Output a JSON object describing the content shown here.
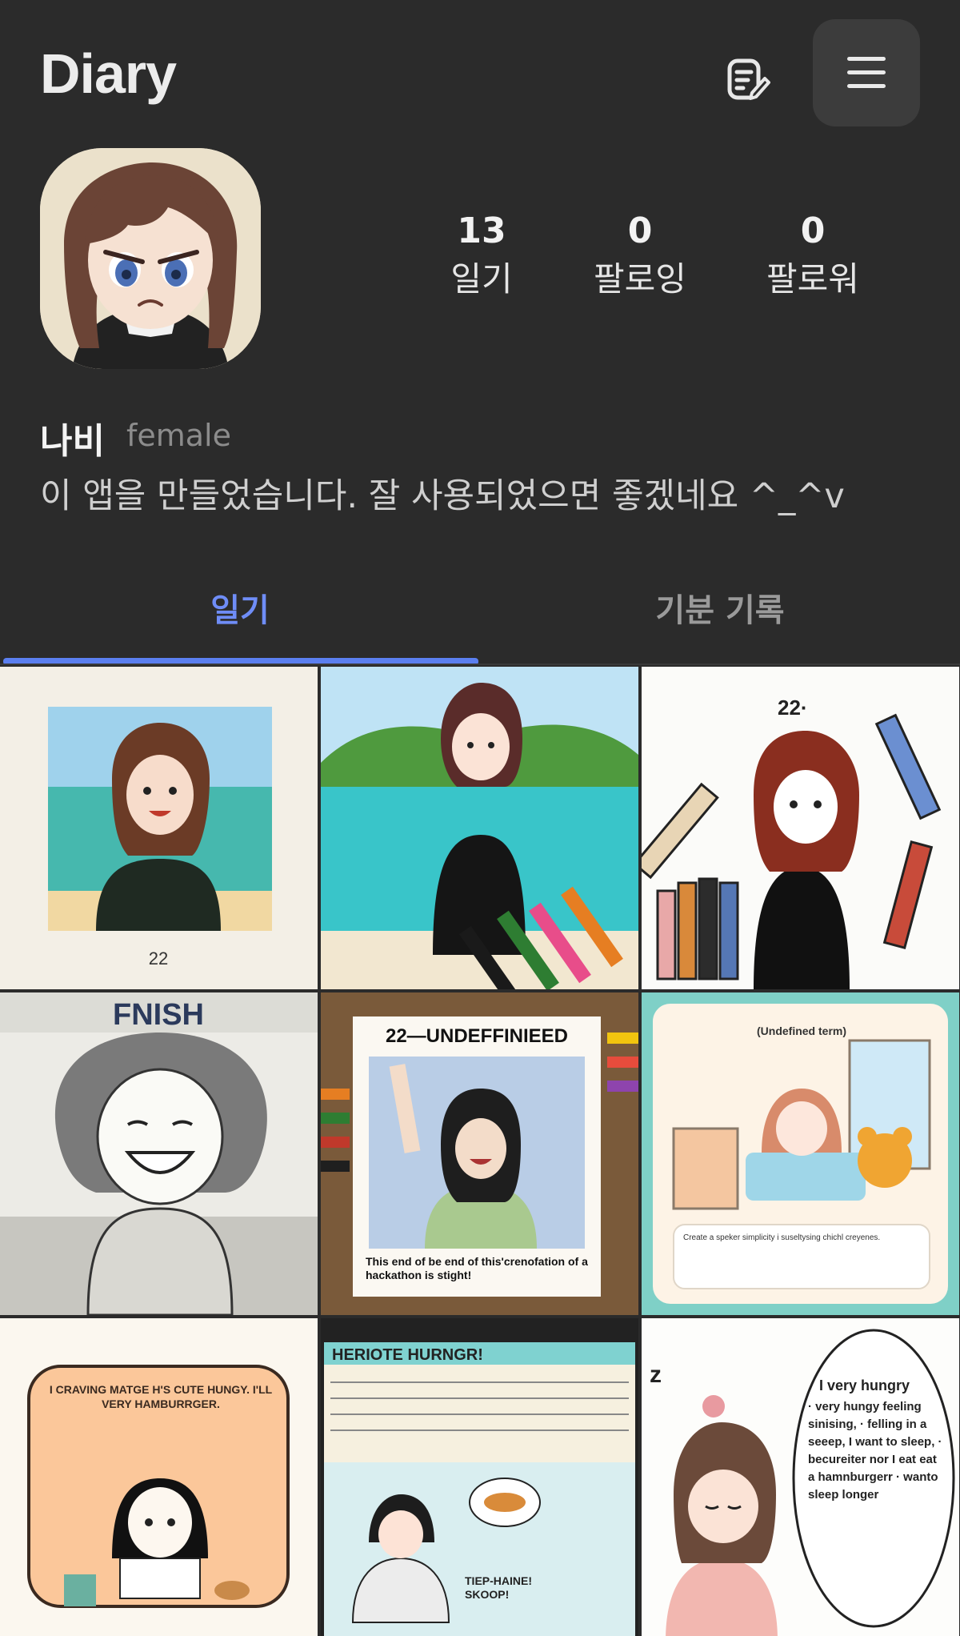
{
  "header": {
    "title": "Diary"
  },
  "profile": {
    "name": "나비",
    "gender": "female",
    "bio": "이 앱을 만들었습니다. 잘 사용되었으면 좋겠네요 ^_^v"
  },
  "stats": [
    {
      "value": "13",
      "label": "일기"
    },
    {
      "value": "0",
      "label": "팔로잉"
    },
    {
      "value": "0",
      "label": "팔로워"
    }
  ],
  "tabs": [
    {
      "label": "일기",
      "active": true
    },
    {
      "label": "기분 기록",
      "active": false
    }
  ],
  "icons": {
    "edit": "note-edit-icon",
    "menu": "hamburger-menu-icon"
  },
  "colors": {
    "background": "#2b2b2b",
    "accent": "#5b7ff0",
    "active_tab": "#6f8df7"
  },
  "tiles": [
    {
      "caption": "22"
    },
    {
      "caption": ""
    },
    {
      "caption": "22·"
    },
    {
      "caption": "FNISH"
    },
    {
      "caption": "22—UNDEFFINIEED",
      "caption2": "This end of be end of this'crenofation of a hackathon is stight!"
    },
    {
      "caption": "(Undefined term)",
      "caption2": "Create a speker simplicity i suseltysing chichl creyenes."
    },
    {
      "caption": "I CRAVING MATGE H'S CUTE HUNGY. I'LL VERY HAMBURRGER."
    },
    {
      "caption": "HERIOTE HURNGR!",
      "caption2": "TIEP-HAINE! SKOOP!"
    },
    {
      "caption": "I very hungry",
      "caption2": "· very hungy feeling sinising, · felling in a seeep, I want to sleep, · becureiter nor I eat eat a hamnburgerr · wanto sleep longer"
    }
  ]
}
